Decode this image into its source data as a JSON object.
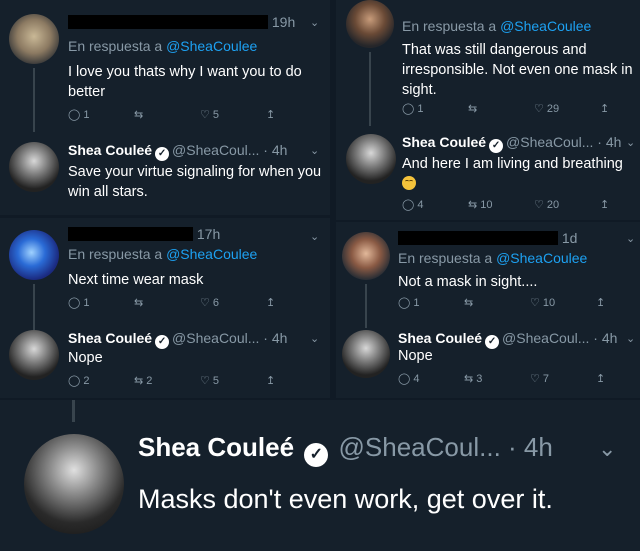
{
  "colors": {
    "background": "#15202b",
    "accent": "#1da1f2",
    "muted": "#8899a6"
  },
  "tl": {
    "reply": {
      "time": "19h",
      "prefix": "En respuesta a",
      "handle": "@SheaCoulee",
      "text": "I love you thats why I want you to do better",
      "replies": "1",
      "retweets": "",
      "likes": "5"
    },
    "shea": {
      "name": "Shea Couleé",
      "handle": "@SheaCoul...",
      "time": "· 4h",
      "text": "Save your virtue signaling for when you win all stars."
    }
  },
  "tr": {
    "reply": {
      "prefix": "En respuesta a",
      "handle": "@SheaCoulee",
      "text": "That was still dangerous and irresponsible. Not even one mask in sight.",
      "replies": "1",
      "retweets": "",
      "likes": "29"
    },
    "shea": {
      "name": "Shea Couleé",
      "handle": "@SheaCoul...",
      "time": "· 4h",
      "text": "And here I am living and breathing",
      "replies": "4",
      "retweets": "10",
      "likes": "20"
    }
  },
  "ml": {
    "reply": {
      "time": "17h",
      "prefix": "En respuesta a",
      "handle": "@SheaCoulee",
      "text": "Next time wear mask",
      "replies": "1",
      "retweets": "",
      "likes": "6"
    },
    "shea": {
      "name": "Shea Couleé",
      "handle": "@SheaCoul...",
      "time": "· 4h",
      "text": "Nope",
      "replies": "2",
      "retweets": "2",
      "likes": "5"
    }
  },
  "mr": {
    "reply": {
      "time": "1d",
      "prefix": "En respuesta a",
      "handle": "@SheaCoulee",
      "text": "Not a mask in sight....",
      "replies": "1",
      "retweets": "",
      "likes": "10"
    },
    "shea": {
      "name": "Shea Couleé",
      "handle": "@SheaCoul...",
      "time": "· 4h",
      "text": "Nope",
      "replies": "4",
      "retweets": "3",
      "likes": "7"
    }
  },
  "bottom": {
    "name": "Shea Couleé",
    "handle": "@SheaCoul...",
    "time": "· 4h",
    "text": "Masks don't even work, get over it."
  }
}
